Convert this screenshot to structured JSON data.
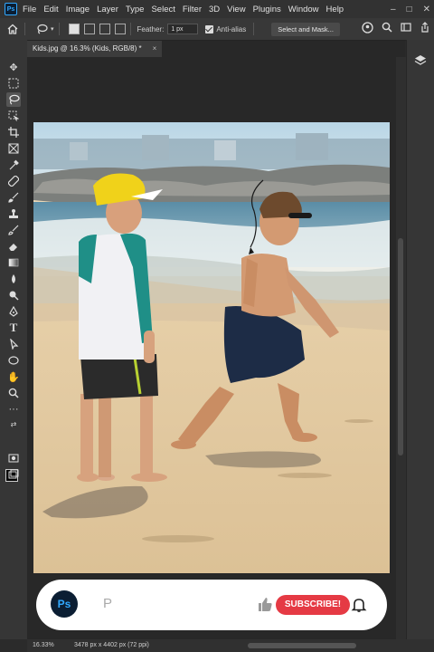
{
  "app": {
    "logo": "Ps"
  },
  "menu": [
    "File",
    "Edit",
    "Image",
    "Layer",
    "Type",
    "Select",
    "Filter",
    "3D",
    "View",
    "Plugins",
    "Window",
    "Help"
  ],
  "window_controls": [
    "–",
    "□",
    "✕"
  ],
  "options": {
    "feather_label": "Feather:",
    "feather_value": "1 px",
    "antialias_label": "Anti-alias",
    "select_mask_label": "Select and Mask..."
  },
  "document": {
    "tab_title": "Kids.jpg @ 16.3% (Kids, RGB/8) *",
    "tab_close": "×"
  },
  "overlay": {
    "logo": "Ps",
    "channel_initial": "P",
    "subscribe_label": "SUBSCRIBE!"
  },
  "status": {
    "zoom": "16.33%",
    "dimensions": "3478 px x 4402 px (72 ppi)"
  },
  "colors": {
    "accent": "#31a8ff",
    "subscribe": "#e53a44",
    "foreground": "#000000",
    "background": "#ffffff"
  }
}
